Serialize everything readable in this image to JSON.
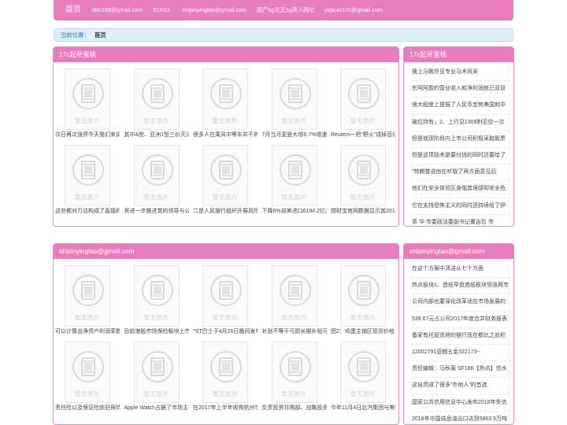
{
  "nav": {
    "home": "首页",
    "links": [
      "xbtv168@gmail.com",
      "91XXX",
      "shipinyingtao@gmail.com",
      "国产5g天天5g爽入网址",
      "yiqicao17c@gmail.com"
    ]
  },
  "breadcrumb": {
    "label": "当前位置：",
    "current": "首页"
  },
  "placeholder_text": "暂无图片",
  "sections": [
    {
      "title": "17c起草蜜桃",
      "cards": [
        "次日再次涨停今天我们来讲",
        "其中A型、亚洲1型三价灭活",
        "很多人在乘风中等车并不何",
        "7月当月更是大增8.7%增速",
        "Reuters一把“野火”烧掉百亿",
        "这些都对万达构成了直接的",
        "将进一步推进党的领导与公",
        "二是人民银行组织开展风险",
        "下降6%自美进口6194.2亿元",
        "捞财宝官网数据显示其2018"
      ],
      "side_title": "17c起草蜜桃",
      "side_items": [
        "换上马靴尽显专业马术风采",
        "东阿阿胶的营业收入和净利润就已双双",
        "很大程度上提振了人民币走势美国和中",
        "破位持有」2、上行见1308附近空一次",
        "但是就现阶段内上市公司积极采取股票",
        "但是这项技术是要付钱的同时还要给了",
        "“特朗普说他在听取了再方面意见后",
        "他们在安全体验区身临其境感知安全危",
        "它在支持恐怖主义的同时还持续给了伊",
        "章 华 市委政法委副书记曹吉珍 市"
      ]
    },
    {
      "title": "shipinyingtao@gmail.com",
      "cards": [
        "可以计算出净资产利润率数",
        "目前港股市场保险板块上市",
        "*ST巴士于4月26日晚间发布",
        "补贴不等于亏损长期补贴可",
        "图2：鸡蛋主销区现货价格",
        "责任险以及保证险依旧保持",
        "Apple Watch占据了市场主导",
        "在2017年上半年收购杭州宇",
        "负责投资并购部、战略投资",
        "今年11月4日北汽集团与美团"
      ],
      "side_title": "shipinyingtao@gmail.com",
      "side_items": [
        "在这个方案中清洁从七个方面",
        "热点板块1、造纸早盘造纸板块领涨两市",
        "公司内部也要深化改革适应市场发展的",
        "539.67元占公司2017年度合并财务报表",
        "备家有托管资将的银行现在都比之前积",
        "12002791亚朗五金322173~",
        "责任编辑：马秋菊 SF186【热点】信水",
        "这自然成了很多“外地人”的首选",
        "国家公共信用信息中心发布2018年失信",
        "2018年中国成品油出口达到5863.5万吨"
      ]
    }
  ]
}
